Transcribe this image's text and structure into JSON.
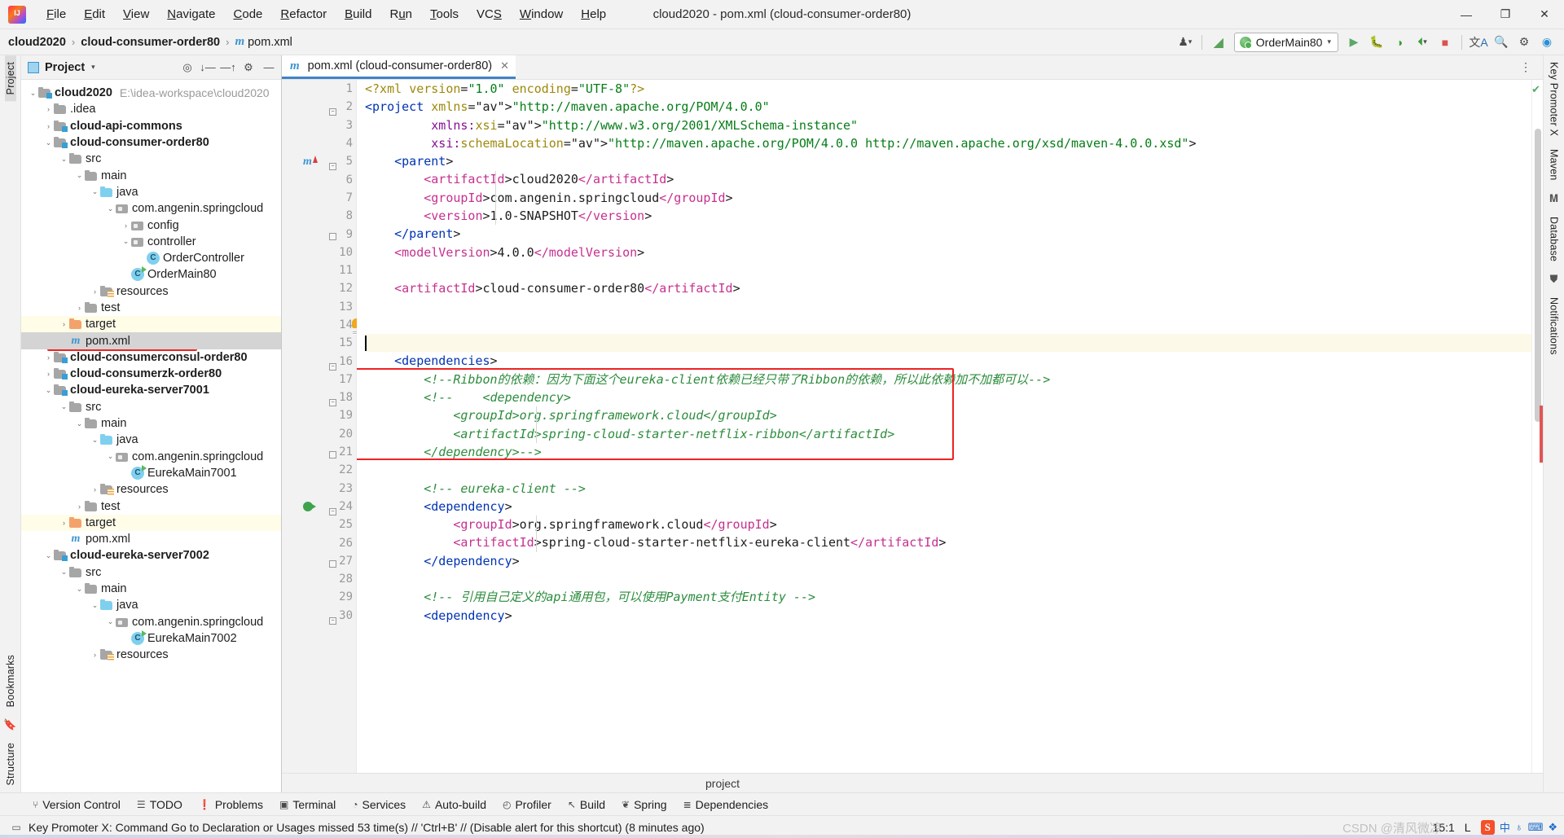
{
  "window": {
    "title": "cloud2020 - pom.xml (cloud-consumer-order80)",
    "minimize": "—",
    "maximize": "❐",
    "close": "✕"
  },
  "menubar": [
    {
      "label": "File"
    },
    {
      "label": "Edit"
    },
    {
      "label": "View"
    },
    {
      "label": "Navigate"
    },
    {
      "label": "Code"
    },
    {
      "label": "Refactor"
    },
    {
      "label": "Build"
    },
    {
      "label": "Run"
    },
    {
      "label": "Tools"
    },
    {
      "label": "VCS"
    },
    {
      "label": "Window"
    },
    {
      "label": "Help"
    }
  ],
  "navbar": {
    "crumbs": [
      "cloud2020",
      "cloud-consumer-order80",
      "pom.xml"
    ],
    "separator": "›",
    "maven_glyph": "m",
    "run_config": "OrderMain80",
    "icons": [
      {
        "name": "user-settings-icon",
        "glyph": "♟"
      },
      {
        "name": "hammer-build-icon",
        "glyph": "↖"
      },
      {
        "name": "run-icon",
        "glyph": "▶"
      },
      {
        "name": "debug-icon",
        "glyph": "⬟"
      },
      {
        "name": "run-coverage-icon",
        "glyph": "◑"
      },
      {
        "name": "profile-icon",
        "glyph": "◴"
      },
      {
        "name": "stop-icon",
        "glyph": "■"
      },
      {
        "name": "translate-icon",
        "glyph": "文A"
      },
      {
        "name": "search-everywhere-icon",
        "glyph": "⌕"
      },
      {
        "name": "settings-gear-icon",
        "glyph": "⚙"
      },
      {
        "name": "ide-features-icon",
        "glyph": "◗"
      }
    ]
  },
  "left_strip": {
    "tabs": [
      "Project",
      "Bookmarks",
      "Structure"
    ]
  },
  "right_strip": {
    "tabs": [
      "Key Promoter X",
      "Maven",
      "Database",
      "Notifications"
    ]
  },
  "project_panel": {
    "title": "Project",
    "dropdown_caret": "▾",
    "actions": [
      {
        "name": "select-opened-file-icon",
        "glyph": "⌖"
      },
      {
        "name": "expand-all-icon",
        "glyph": "⤓"
      },
      {
        "name": "collapse-all-icon",
        "glyph": "⤒"
      },
      {
        "name": "panel-settings-icon",
        "glyph": "⚙"
      },
      {
        "name": "hide-panel-icon",
        "glyph": "—"
      }
    ],
    "tree": [
      {
        "depth": 0,
        "arrow": "down",
        "icon": "module",
        "label": "cloud2020",
        "bold": true,
        "path": "E:\\idea-workspace\\cloud2020"
      },
      {
        "depth": 1,
        "arrow": "right",
        "icon": "folder",
        "label": ".idea",
        "bold": false
      },
      {
        "depth": 1,
        "arrow": "right",
        "icon": "module",
        "label": "cloud-api-commons",
        "bold": true
      },
      {
        "depth": 1,
        "arrow": "down",
        "icon": "module",
        "label": "cloud-consumer-order80",
        "bold": true
      },
      {
        "depth": 2,
        "arrow": "down",
        "icon": "folder",
        "label": "src",
        "bold": false
      },
      {
        "depth": 3,
        "arrow": "down",
        "icon": "folder",
        "label": "main",
        "bold": false
      },
      {
        "depth": 4,
        "arrow": "down",
        "icon": "src",
        "label": "java",
        "bold": false
      },
      {
        "depth": 5,
        "arrow": "down",
        "icon": "pkg",
        "label": "com.angenin.springcloud",
        "bold": false
      },
      {
        "depth": 6,
        "arrow": "right",
        "icon": "pkg",
        "label": "config",
        "bold": false
      },
      {
        "depth": 6,
        "arrow": "down",
        "icon": "pkg",
        "label": "controller",
        "bold": false
      },
      {
        "depth": 7,
        "arrow": "none",
        "icon": "cls",
        "label": "OrderController",
        "bold": false
      },
      {
        "depth": 6,
        "arrow": "none",
        "icon": "clsrun",
        "label": "OrderMain80",
        "bold": false
      },
      {
        "depth": 4,
        "arrow": "right",
        "icon": "res",
        "label": "resources",
        "bold": false
      },
      {
        "depth": 3,
        "arrow": "right",
        "icon": "folder",
        "label": "test",
        "bold": false
      },
      {
        "depth": 2,
        "arrow": "right",
        "icon": "orange",
        "label": "target",
        "bold": false,
        "highlight": true
      },
      {
        "depth": 2,
        "arrow": "none",
        "icon": "mvn",
        "label": "pom.xml",
        "bold": false,
        "selected": true,
        "boxed": true
      },
      {
        "depth": 1,
        "arrow": "right",
        "icon": "module",
        "label": "cloud-consumerconsul-order80",
        "bold": true
      },
      {
        "depth": 1,
        "arrow": "right",
        "icon": "module",
        "label": "cloud-consumerzk-order80",
        "bold": true
      },
      {
        "depth": 1,
        "arrow": "down",
        "icon": "module",
        "label": "cloud-eureka-server7001",
        "bold": true
      },
      {
        "depth": 2,
        "arrow": "down",
        "icon": "folder",
        "label": "src",
        "bold": false
      },
      {
        "depth": 3,
        "arrow": "down",
        "icon": "folder",
        "label": "main",
        "bold": false
      },
      {
        "depth": 4,
        "arrow": "down",
        "icon": "src",
        "label": "java",
        "bold": false
      },
      {
        "depth": 5,
        "arrow": "down",
        "icon": "pkg",
        "label": "com.angenin.springcloud",
        "bold": false
      },
      {
        "depth": 6,
        "arrow": "none",
        "icon": "clsrun",
        "label": "EurekaMain7001",
        "bold": false
      },
      {
        "depth": 4,
        "arrow": "right",
        "icon": "res",
        "label": "resources",
        "bold": false
      },
      {
        "depth": 3,
        "arrow": "right",
        "icon": "folder",
        "label": "test",
        "bold": false
      },
      {
        "depth": 2,
        "arrow": "right",
        "icon": "orange",
        "label": "target",
        "bold": false,
        "highlight": true
      },
      {
        "depth": 2,
        "arrow": "none",
        "icon": "mvn",
        "label": "pom.xml",
        "bold": false
      },
      {
        "depth": 1,
        "arrow": "down",
        "icon": "module",
        "label": "cloud-eureka-server7002",
        "bold": true
      },
      {
        "depth": 2,
        "arrow": "down",
        "icon": "folder",
        "label": "src",
        "bold": false
      },
      {
        "depth": 3,
        "arrow": "down",
        "icon": "folder",
        "label": "main",
        "bold": false
      },
      {
        "depth": 4,
        "arrow": "down",
        "icon": "src",
        "label": "java",
        "bold": false
      },
      {
        "depth": 5,
        "arrow": "down",
        "icon": "pkg",
        "label": "com.angenin.springcloud",
        "bold": false
      },
      {
        "depth": 6,
        "arrow": "none",
        "icon": "clsrun",
        "label": "EurekaMain7002",
        "bold": false
      },
      {
        "depth": 4,
        "arrow": "right",
        "icon": "res",
        "label": "resources",
        "bold": false
      }
    ]
  },
  "editor": {
    "tab_label": "pom.xml (cloud-consumer-order80)",
    "tab_icon_glyph": "m",
    "tab_close_glyph": "✕",
    "caret_position": "15:1",
    "inspection_ok_glyph": "✔",
    "bulb_line": 14,
    "breadcrumb": "project",
    "lines": [
      {
        "n": 1,
        "text": "<?xml version=\"1.0\" encoding=\"UTF-8\"?>"
      },
      {
        "n": 2,
        "text": "<project xmlns=\"http://maven.apache.org/POM/4.0.0\""
      },
      {
        "n": 3,
        "text": "         xmlns:xsi=\"http://www.w3.org/2001/XMLSchema-instance\""
      },
      {
        "n": 4,
        "text": "         xsi:schemaLocation=\"http://maven.apache.org/POM/4.0.0 http://maven.apache.org/xsd/maven-4.0.0.xsd\">"
      },
      {
        "n": 5,
        "text": "    <parent>"
      },
      {
        "n": 6,
        "text": "        <artifactId>cloud2020</artifactId>"
      },
      {
        "n": 7,
        "text": "        <groupId>com.angenin.springcloud</groupId>"
      },
      {
        "n": 8,
        "text": "        <version>1.0-SNAPSHOT</version>"
      },
      {
        "n": 9,
        "text": "    </parent>"
      },
      {
        "n": 10,
        "text": "    <modelVersion>4.0.0</modelVersion>"
      },
      {
        "n": 11,
        "text": ""
      },
      {
        "n": 12,
        "text": "    <artifactId>cloud-consumer-order80</artifactId>"
      },
      {
        "n": 13,
        "text": ""
      },
      {
        "n": 14,
        "text": ""
      },
      {
        "n": 15,
        "text": ""
      },
      {
        "n": 16,
        "text": "    <dependencies>"
      },
      {
        "n": 17,
        "text": "        <!--Ribbon的依赖：因为下面这个eureka-client依赖已经只带了Ribbon的依赖，所以此依赖加不加都可以-->"
      },
      {
        "n": 18,
        "text": "        <!--    <dependency>"
      },
      {
        "n": 19,
        "text": "            <groupId>org.springframework.cloud</groupId>"
      },
      {
        "n": 20,
        "text": "            <artifactId>spring-cloud-starter-netflix-ribbon</artifactId>"
      },
      {
        "n": 21,
        "text": "        </dependency>-->"
      },
      {
        "n": 22,
        "text": ""
      },
      {
        "n": 23,
        "text": "        <!-- eureka-client -->"
      },
      {
        "n": 24,
        "text": "        <dependency>"
      },
      {
        "n": 25,
        "text": "            <groupId>org.springframework.cloud</groupId>"
      },
      {
        "n": 26,
        "text": "            <artifactId>spring-cloud-starter-netflix-eureka-client</artifactId>"
      },
      {
        "n": 27,
        "text": "        </dependency>"
      },
      {
        "n": 28,
        "text": ""
      },
      {
        "n": 29,
        "text": "        <!-- 引用自己定义的api通用包，可以使用Payment支付Entity -->"
      },
      {
        "n": 30,
        "text": "        <dependency>"
      }
    ]
  },
  "toolwindows": [
    {
      "label": "Version Control",
      "icon": "branch-icon",
      "glyph": "⑂"
    },
    {
      "label": "TODO",
      "icon": "todo-list-icon",
      "glyph": "☰"
    },
    {
      "label": "Problems",
      "icon": "problems-icon",
      "glyph": "❗"
    },
    {
      "label": "Terminal",
      "icon": "terminal-icon",
      "glyph": "▣"
    },
    {
      "label": "Services",
      "icon": "services-icon",
      "glyph": "◔"
    },
    {
      "label": "Auto-build",
      "icon": "warning-triangle-icon",
      "glyph": "⚠"
    },
    {
      "label": "Profiler",
      "icon": "profiler-icon",
      "glyph": "◴"
    },
    {
      "label": "Build",
      "icon": "hammer-icon",
      "glyph": "↖"
    },
    {
      "label": "Spring",
      "icon": "spring-leaf-icon",
      "glyph": "❦"
    },
    {
      "label": "Dependencies",
      "icon": "dependencies-icon",
      "glyph": "≣"
    }
  ],
  "statusbar": {
    "message": "Key Promoter X: Command Go to Declaration or Usages missed 53 time(s) // 'Ctrl+B' // (Disable alert for this shortcut) (8 minutes ago)",
    "message_icon_glyph": "▭",
    "caret": "15:1",
    "line_sep": "L",
    "watermark": "CSDN @清风微凉",
    "tray": [
      {
        "name": "sogou-ime-icon",
        "label": "S"
      },
      {
        "name": "ime-chinese-icon",
        "label": "中"
      },
      {
        "name": "ime-mic-icon",
        "label": "♁"
      },
      {
        "name": "ime-keyboard-icon",
        "label": "⌨"
      },
      {
        "name": "ime-toolbox-icon",
        "label": "❖"
      }
    ]
  },
  "colors": {
    "accent_blue": "#4083c9",
    "red_box": "#ee2222",
    "tag_blue": "#0033b3",
    "string_green": "#067d17",
    "comment_green": "#2c8c3c",
    "attr_yellow": "#9e880d",
    "ns_purple": "#871094",
    "highlight_yellow": "#fdf9e8",
    "target_folder_hl": "#fffce8"
  }
}
